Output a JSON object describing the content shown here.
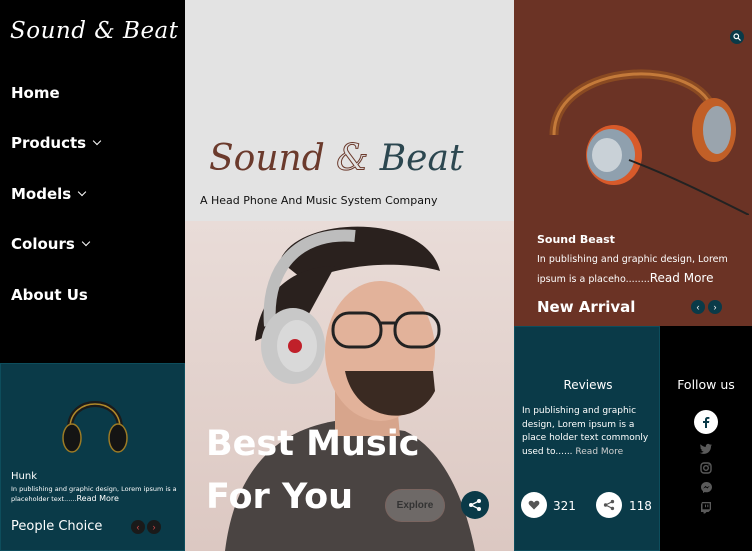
{
  "brand": {
    "logo_text": "Sound & Beat",
    "name_part1": "Sound",
    "name_amp": "&",
    "name_part2": "Beat",
    "tagline": "A Head Phone And Music System Company"
  },
  "nav": {
    "items": [
      {
        "label": "Home",
        "has_dropdown": false
      },
      {
        "label": "Products",
        "has_dropdown": true
      },
      {
        "label": "Models",
        "has_dropdown": true
      },
      {
        "label": "Colours",
        "has_dropdown": true
      },
      {
        "label": "About Us",
        "has_dropdown": false
      }
    ]
  },
  "people_choice": {
    "product": "Hunk",
    "desc": "In publishing and graphic design, Lorem ipsum is a placeholder text......",
    "read_more": "Read More",
    "label": "People Choice",
    "prev": "‹",
    "next": "›"
  },
  "hero": {
    "line1": "Best Music",
    "line2": "For You",
    "explore_label": "Explore"
  },
  "new_arrival": {
    "product": "Sound Beast",
    "desc": "In publishing and graphic design, Lorem ipsum is a placeho........",
    "read_more": "Read More",
    "label": "New Arrival",
    "prev": "‹",
    "next": "›"
  },
  "reviews": {
    "title": "Reviews",
    "desc": "In publishing and graphic design, Lorem ipsum is a place holder text commonly used to......",
    "read_more": "Read More",
    "likes": "321",
    "shares": "118"
  },
  "follow": {
    "title": "Follow us",
    "icons": [
      "facebook-icon",
      "twitter-icon",
      "instagram-icon",
      "messenger-icon",
      "twitch-icon"
    ]
  },
  "colors": {
    "dark_teal": "#0a3a48",
    "brown": "#6b3325",
    "light_grey": "#e3e3e3"
  }
}
